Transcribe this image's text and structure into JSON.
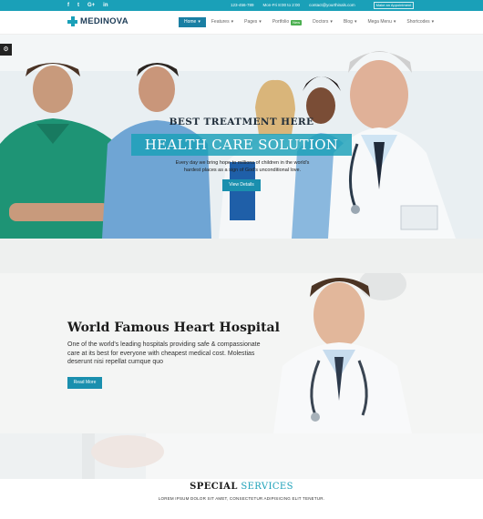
{
  "topbar": {
    "social": [
      "f",
      "t",
      "G+",
      "in"
    ],
    "contacts": [
      "123-456-789",
      "Mon-Fri 8:00 to 2:00",
      "contact@yourthinals.com"
    ],
    "appointment_label": "Make an Appointment"
  },
  "brand": {
    "name": "MEDINOVA"
  },
  "nav": {
    "items": [
      {
        "label": "Home",
        "active": true
      },
      {
        "label": "Features",
        "active": false
      },
      {
        "label": "Pages",
        "active": false
      },
      {
        "label": "Portfolio",
        "active": false,
        "badge": "New"
      },
      {
        "label": "Doctors",
        "active": false
      },
      {
        "label": "Blog",
        "active": false
      },
      {
        "label": "Mega Menu",
        "active": false
      },
      {
        "label": "Shortcodes",
        "active": false
      }
    ]
  },
  "side_toggle_icon": "sliders-icon",
  "hero": {
    "kicker": "BEST TREATMENT HERE",
    "title": "HEALTH CARE SOLUTION",
    "description": "Every day we bring hope to millions of children in the world's hardest places as a sign of God's unconditional love.",
    "button": "View Details"
  },
  "feature": {
    "title": "World Famous Heart Hospital",
    "description": "One of the world's leading hospitals providing safe & compassionate care at its best for everyone with cheapest medical cost. Molestias deserunt nisi repellat cumque quo",
    "button": "Read More"
  },
  "services": {
    "title_a": "SPECIAL",
    "title_b": "SERVICES",
    "subtitle": "LOREM IPSUM DOLOR SIT AMET, CONSECTETUR ADIPISICING ELIT TENETUR."
  },
  "colors": {
    "primary": "#1aa0b8",
    "button": "#1a8fae",
    "nav_active": "#1a7fa3",
    "badge": "#4caf50"
  }
}
